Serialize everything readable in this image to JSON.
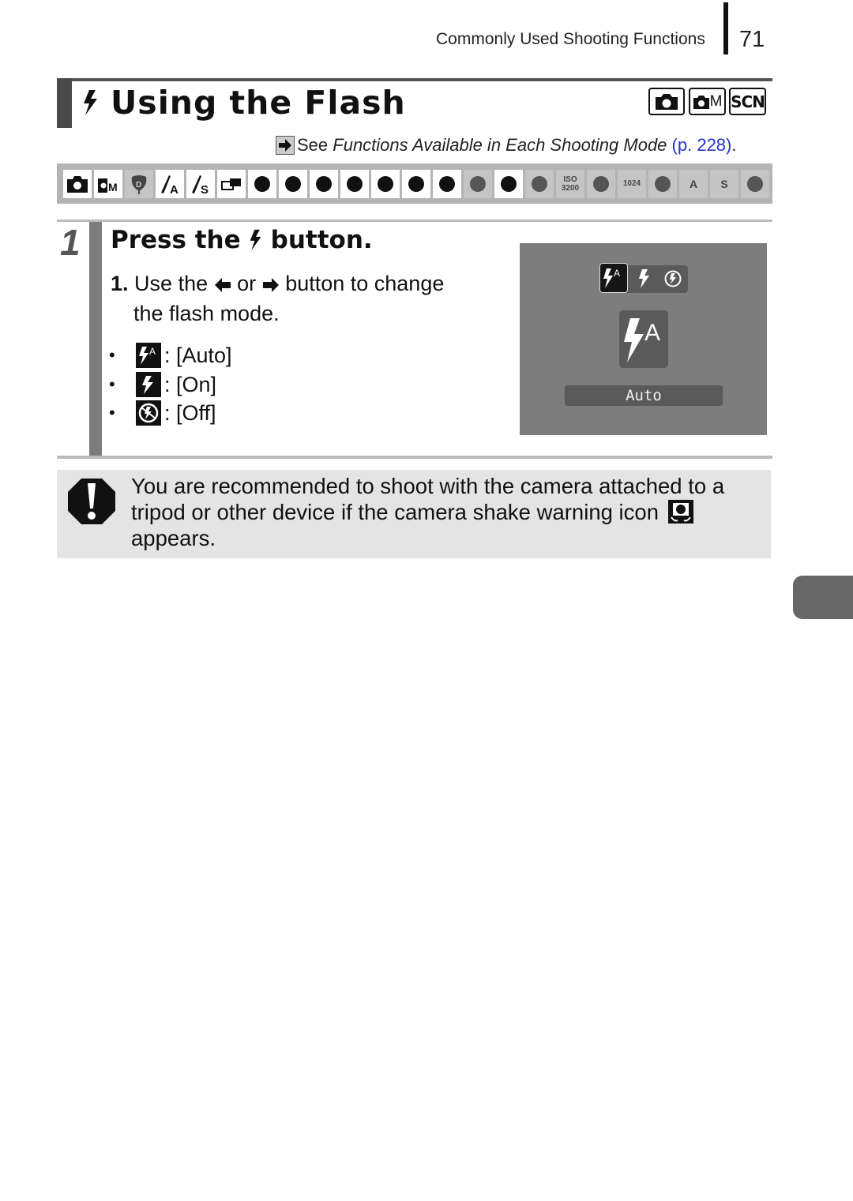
{
  "header": {
    "running_head": "Commonly Used Shooting Functions",
    "page_number": "71"
  },
  "section": {
    "title": "Using the Flash",
    "title_icon": "flash-icon",
    "modes": [
      {
        "name": "auto-mode-icon",
        "label": ""
      },
      {
        "name": "manual-mode-icon",
        "label": "M"
      },
      {
        "name": "scene-mode-icon",
        "label": "SCN"
      }
    ],
    "reference": {
      "prefix": "See ",
      "italic": "Functions Available in Each Shooting Mode",
      "link": "(p. 228)",
      "suffix": "."
    }
  },
  "mode_icons": [
    {
      "name": "auto-icon",
      "label": "",
      "available": true
    },
    {
      "name": "manual-icon",
      "label": "M",
      "available": true
    },
    {
      "name": "digital-macro-icon",
      "label": "D",
      "available": false
    },
    {
      "name": "color-accent-icon",
      "label": "A",
      "available": true
    },
    {
      "name": "color-swap-icon",
      "label": "S",
      "available": true
    },
    {
      "name": "stitch-assist-icon",
      "label": "",
      "available": true
    },
    {
      "name": "portrait-icon",
      "label": "",
      "available": true
    },
    {
      "name": "night-snapshot-icon",
      "label": "",
      "available": true
    },
    {
      "name": "kids-pets-icon",
      "label": "",
      "available": true
    },
    {
      "name": "indoor-icon",
      "label": "",
      "available": true
    },
    {
      "name": "foliage-icon",
      "label": "",
      "available": true
    },
    {
      "name": "snow-icon",
      "label": "",
      "available": true
    },
    {
      "name": "beach-icon",
      "label": "",
      "available": true
    },
    {
      "name": "fireworks-icon",
      "label": "",
      "available": false
    },
    {
      "name": "aquarium-icon",
      "label": "",
      "available": true
    },
    {
      "name": "underwater-icon",
      "label": "",
      "available": false
    },
    {
      "name": "iso-3200-icon",
      "label": "ISO 3200",
      "available": false
    },
    {
      "name": "movie-standard-icon",
      "label": "",
      "available": false
    },
    {
      "name": "movie-1024-icon",
      "label": "1024",
      "available": false
    },
    {
      "name": "movie-email-icon",
      "label": "",
      "available": false
    },
    {
      "name": "movie-color-accent-icon",
      "label": "A",
      "available": false
    },
    {
      "name": "movie-color-swap-icon",
      "label": "S",
      "available": false
    },
    {
      "name": "movie-fast-frame-icon",
      "label": "",
      "available": false
    }
  ],
  "step": {
    "number": "1",
    "title_pre": "Press the",
    "title_post": "button.",
    "instruction_num": "1.",
    "instruction_a": "Use the",
    "instruction_or": "or",
    "instruction_b": "button to change",
    "instruction_c": "the flash mode.",
    "options": [
      {
        "icon": "flash-auto-icon",
        "label": ": [Auto]"
      },
      {
        "icon": "flash-on-icon",
        "label": ": [On]"
      },
      {
        "icon": "flash-off-icon",
        "label": ": [Off]"
      }
    ]
  },
  "camera_screen": {
    "selected_mode": "Auto",
    "label": "Auto"
  },
  "caution": {
    "line1": "You are recommended to shoot with the camera attached to a",
    "line2": "tripod or other device if the camera shake warning icon",
    "line3": "appears."
  }
}
